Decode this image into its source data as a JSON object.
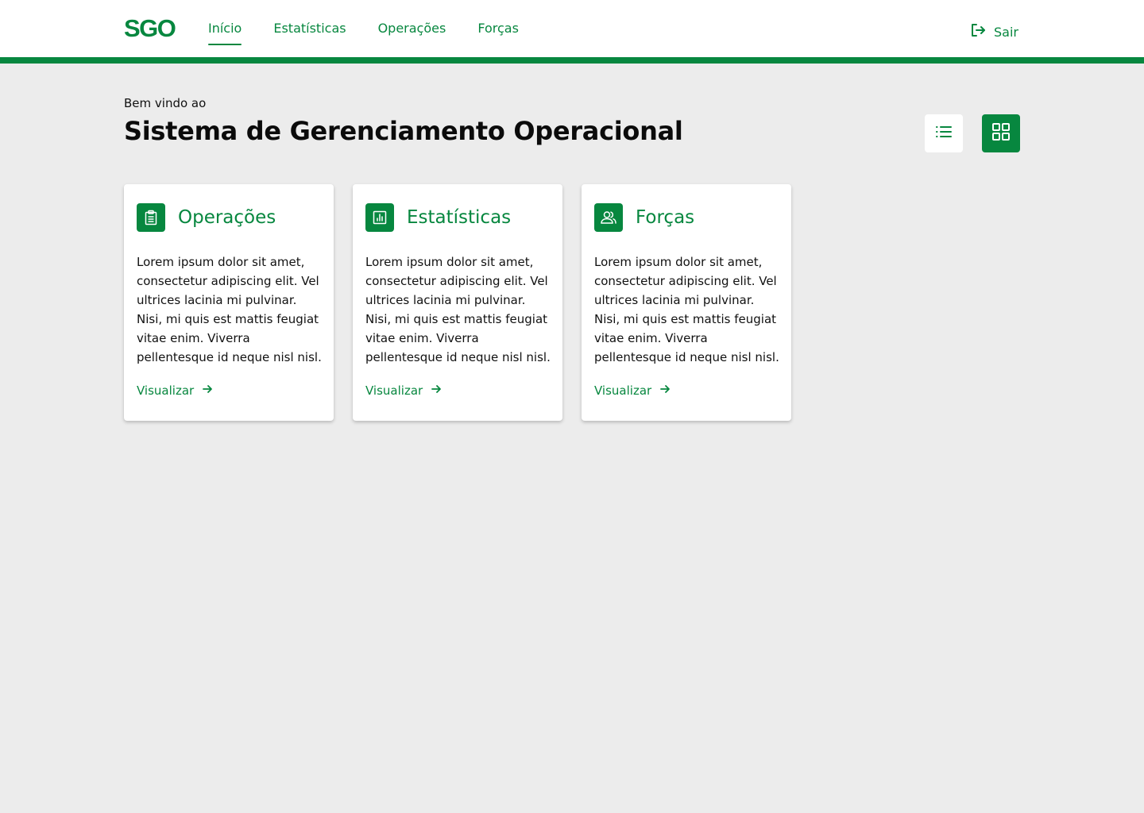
{
  "header": {
    "logo": "SGO",
    "nav": [
      {
        "label": "Início",
        "active": true
      },
      {
        "label": "Estatísticas",
        "active": false
      },
      {
        "label": "Operações",
        "active": false
      },
      {
        "label": "Forças",
        "active": false
      }
    ],
    "logout_label": "Sair"
  },
  "main": {
    "welcome": "Bem vindo ao",
    "title": "Sistema de Gerenciamento Operacional",
    "view_toggle": {
      "selected": "grid"
    },
    "cards": [
      {
        "icon": "clipboard-icon",
        "title": "Operações",
        "text": "Lorem ipsum dolor sit amet, consectetur adipiscing elit. Vel ultrices lacinia mi pulvinar. Nisi, mi quis est mattis feugiat vitae enim. Viverra pellentesque id neque nisl nisl.",
        "link": "Visualizar"
      },
      {
        "icon": "chart-icon",
        "title": "Estatísticas",
        "text": "Lorem ipsum dolor sit amet, consectetur adipiscing elit. Vel ultrices lacinia mi pulvinar. Nisi, mi quis est mattis feugiat vitae enim. Viverra pellentesque id neque nisl nisl.",
        "link": "Visualizar"
      },
      {
        "icon": "users-icon",
        "title": "Forças",
        "text": "Lorem ipsum dolor sit amet, consectetur adipiscing elit. Vel ultrices lacinia mi pulvinar. Nisi, mi quis est mattis feugiat vitae enim. Viverra pellentesque id neque nisl nisl.",
        "link": "Visualizar"
      }
    ]
  },
  "colors": {
    "brand": "#07873f",
    "background": "#ececec",
    "surface": "#ffffff"
  }
}
